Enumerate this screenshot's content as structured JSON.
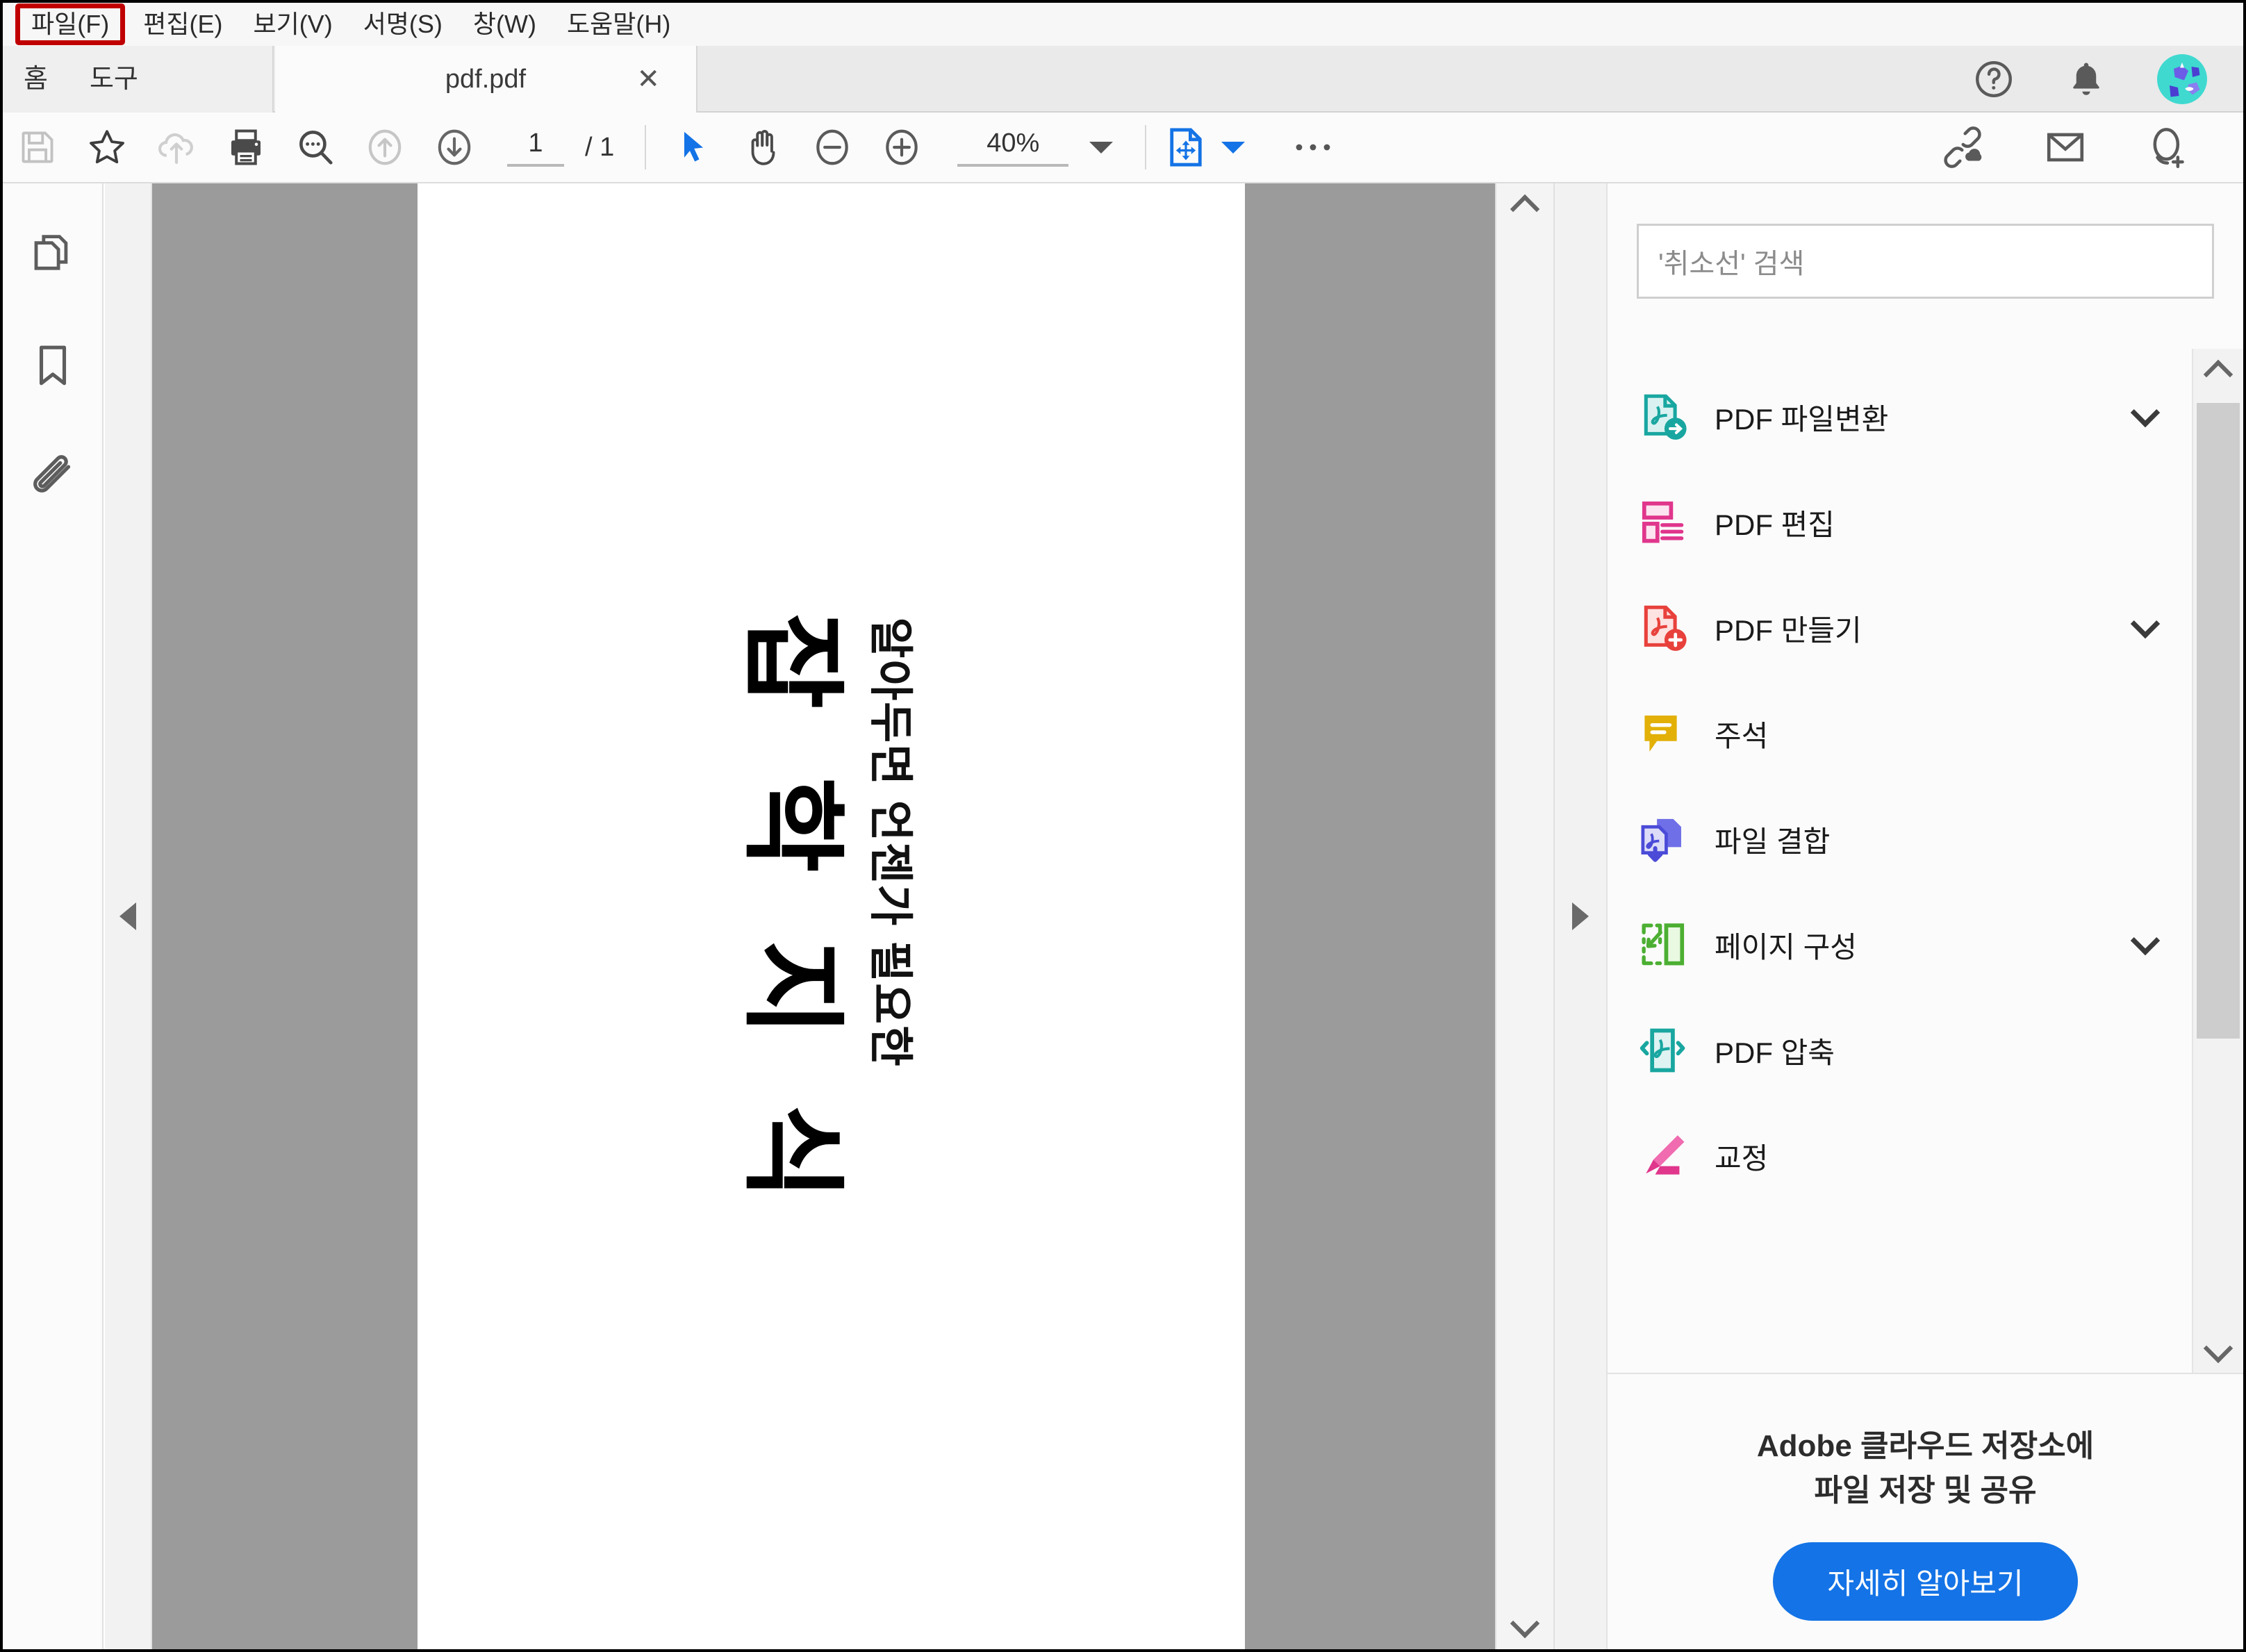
{
  "menubar": {
    "items": [
      {
        "label": "파일(F)",
        "highlighted": true
      },
      {
        "label": "편집(E)",
        "highlighted": false
      },
      {
        "label": "보기(V)",
        "highlighted": false
      },
      {
        "label": "서명(S)",
        "highlighted": false
      },
      {
        "label": "창(W)",
        "highlighted": false
      },
      {
        "label": "도움말(H)",
        "highlighted": false
      }
    ],
    "highlight_color": "#c00000"
  },
  "tabbar": {
    "home_label": "홈",
    "tools_label": "도구",
    "document_tab": "pdf.pdf",
    "close_label": "✕",
    "help_icon": "help-circle-icon",
    "bell_icon": "notification-bell-icon",
    "avatar_icon": "user-avatar-icon"
  },
  "toolbar": {
    "save_icon": "save-icon",
    "star_icon": "star-icon",
    "cloud_upload_icon": "cloud-upload-icon",
    "print_icon": "print-icon",
    "search_icon": "search-icon",
    "prev_page_icon": "arrow-up-circle-icon",
    "next_page_icon": "arrow-down-circle-icon",
    "page_current": "1",
    "page_total": "/ 1",
    "select_tool_icon": "cursor-arrow-icon",
    "hand_tool_icon": "hand-icon",
    "zoom_out_icon": "zoom-out-icon",
    "zoom_in_icon": "zoom-in-icon",
    "zoom_value": "40%",
    "fit_page_icon": "fit-page-icon",
    "more_icon": "more-options-icon",
    "share_link_icon": "share-link-icon",
    "email_icon": "email-icon",
    "add_person_icon": "add-person-icon",
    "accent_blue": "#1473e6"
  },
  "leftrail": {
    "items": [
      {
        "icon": "page-thumbnails-icon",
        "name": "page-thumbnails"
      },
      {
        "icon": "bookmark-icon",
        "name": "bookmarks"
      },
      {
        "icon": "attachment-icon",
        "name": "attachments"
      }
    ]
  },
  "document": {
    "subtitle": "알아두면 언젠가 필요한",
    "title": "잡 학 지 식",
    "page_bg": "#ffffff",
    "band_color": "#9b9b9b"
  },
  "rightpanel": {
    "search_placeholder": "'취소선' 검색",
    "tools": [
      {
        "label": "PDF 파일변환",
        "icon": "pdf-convert-icon",
        "color": "#19a6a0",
        "expandable": true
      },
      {
        "label": "PDF 편집",
        "icon": "pdf-edit-icon",
        "color": "#e0368c",
        "expandable": false
      },
      {
        "label": "PDF 만들기",
        "icon": "pdf-create-icon",
        "color": "#e8413c",
        "expandable": true
      },
      {
        "label": "주석",
        "icon": "comment-icon",
        "color": "#e2b007",
        "expandable": false
      },
      {
        "label": "파일 결합",
        "icon": "combine-files-icon",
        "color": "#5a5ae6",
        "expandable": false
      },
      {
        "label": "페이지 구성",
        "icon": "organize-pages-icon",
        "color": "#5cc23a",
        "expandable": true
      },
      {
        "label": "PDF 압축",
        "icon": "compress-pdf-icon",
        "color": "#19a6a0",
        "expandable": false
      },
      {
        "label": "교정",
        "icon": "redact-icon",
        "color": "#e0368c",
        "expandable": false
      }
    ],
    "promo": {
      "line1": "Adobe 클라우드 저장소에",
      "line2": "파일 저장 및 공유",
      "button_label": "자세히 알아보기",
      "button_color": "#1473e6"
    }
  }
}
